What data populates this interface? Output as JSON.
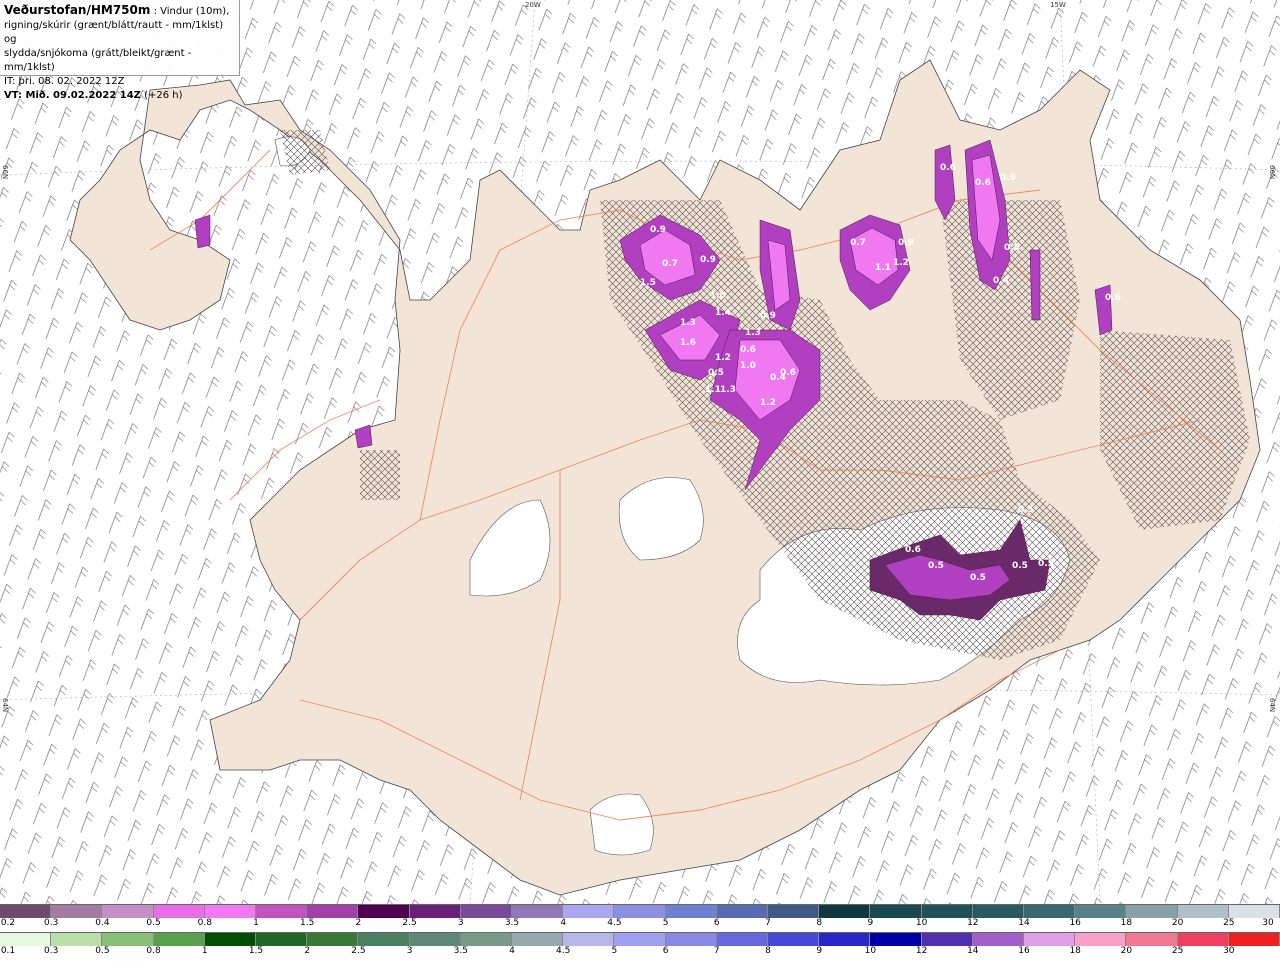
{
  "header": {
    "title": "Veðurstofan/HM750m",
    "subtitle_1": " : Vindur (10m),",
    "line_2": "rigning/skúrir (grænt/blátt/rautt - mm/1klst) og",
    "line_3": "slydda/snjókoma (grátt/bleikt/grænt - mm/1klst)",
    "line_4": "IT: þri. 08. 02. 2022 12Z",
    "vt_label": "VT: Mið. 09.02.2022 14Z",
    "vt_offset": " (+26 h)"
  },
  "grid_labels": {
    "lon_20w": "20W",
    "lon_15w": "15W",
    "lat_66n_left": "66N",
    "lat_66n_right": "66N",
    "lat_64n_left": "64N",
    "lat_64n_right": "64N"
  },
  "map_value_labels": [
    "0.9",
    "0.7",
    "0.9",
    "1.5",
    "1.0",
    "1.3",
    "1.4",
    "1.3",
    "0.9",
    "1.6",
    "1.2",
    "0.6",
    "1.0",
    "0.4",
    "1.2",
    "0.5",
    "1.1",
    "1.3",
    "0.7",
    "0.9",
    "1.1",
    "1.2",
    "0.6",
    "0.6",
    "0.9",
    "0.5",
    "0.4",
    "0.6",
    "0.6",
    "0.5",
    "0.5",
    "0.5",
    "0.5",
    "0.5",
    "0.6"
  ],
  "legend_top": {
    "labels": [
      "0.2",
      "0.3",
      "0.4",
      "0.5",
      "0.8",
      "1",
      "1.5",
      "2",
      "2.5",
      "3",
      "3.5",
      "4",
      "4.5",
      "5",
      "6",
      "7",
      "8",
      "9",
      "10",
      "12",
      "14",
      "16",
      "18",
      "20",
      "25",
      "30"
    ],
    "colors": [
      "#6e4a6e",
      "#a37ca3",
      "#c48fc4",
      "#e86ee8",
      "#f078f0",
      "#c055c0",
      "#a040a8",
      "#500050",
      "#682078",
      "#7a4a9a",
      "#8e78b8",
      "#a8a8f0",
      "#8c90e0",
      "#7080d0",
      "#5a6ab0",
      "#405888",
      "#103840",
      "#184850",
      "#205058",
      "#285860",
      "#3a6870",
      "#5a8088",
      "#8aa0a8",
      "#b0c0c8",
      "#d8e0e8"
    ]
  },
  "legend_bottom": {
    "labels": [
      "0.1",
      "0.3",
      "0.5",
      "0.8",
      "1",
      "1.5",
      "2",
      "2.5",
      "3",
      "3.5",
      "4",
      "4.5",
      "5",
      "6",
      "7",
      "8",
      "9",
      "10",
      "12",
      "14",
      "16",
      "18",
      "20",
      "25",
      "30"
    ],
    "colors": [
      "#e8f8e0",
      "#b8e0a8",
      "#88c078",
      "#58a050",
      "#005000",
      "#206828",
      "#3a7838",
      "#4a8060",
      "#608878",
      "#789888",
      "#98a8b0",
      "#b8b8e8",
      "#a0a0f0",
      "#8888e8",
      "#6868e0",
      "#4848d8",
      "#2828c8",
      "#0000a8",
      "#5030b0",
      "#a060c8",
      "#e0a0e8",
      "#f8a0c8",
      "#f07890",
      "#f04060",
      "#f02020"
    ]
  },
  "colors": {
    "land": "#f2e5d8",
    "roads": "#ee7a4a",
    "glacier": "#ffffff",
    "hatch": "#5a5050",
    "precip_light": "#f078f0",
    "precip_mid": "#b040c0",
    "precip_dark": "#6a2a6a"
  }
}
